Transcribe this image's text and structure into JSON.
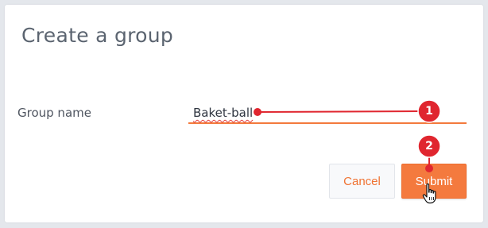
{
  "dialog": {
    "title": "Create a group",
    "field": {
      "label": "Group name",
      "value": "Baket-ball"
    },
    "buttons": {
      "cancel_label": "Cancel",
      "submit_label": "Submit"
    }
  },
  "annotations": [
    {
      "number": "1",
      "target": "group-name-input"
    },
    {
      "number": "2",
      "target": "submit-button"
    }
  ],
  "colors": {
    "accent": "#f47a3e",
    "marker": "#e0262f",
    "title_text": "#5b6470"
  },
  "icons": {
    "cursor": "hand-pointer-icon"
  }
}
